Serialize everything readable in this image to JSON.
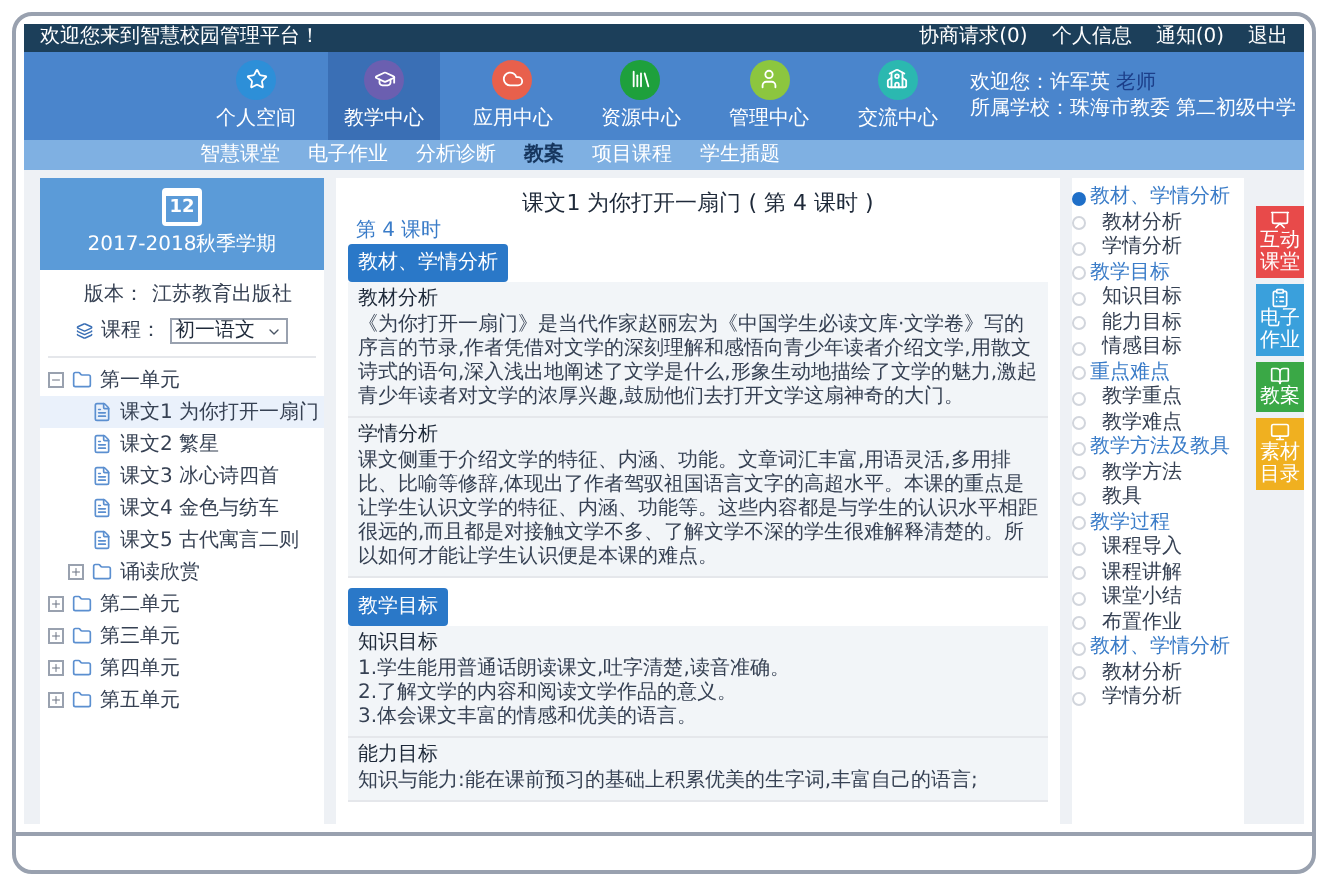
{
  "top_bar": {
    "welcome": "欢迎您来到智慧校园管理平台！",
    "links": [
      "协商请求(0)",
      "个人信息",
      "通知(0)",
      "退出"
    ]
  },
  "nav": {
    "items": [
      {
        "label": "个人空间",
        "color": "#2d8fd8",
        "selected": false
      },
      {
        "label": "教学中心",
        "color": "#6b5fb0",
        "selected": true
      },
      {
        "label": "应用中心",
        "color": "#e8604c",
        "selected": false
      },
      {
        "label": "资源中心",
        "color": "#1ea03c",
        "selected": false
      },
      {
        "label": "管理中心",
        "color": "#8cc63f",
        "selected": false
      },
      {
        "label": "交流中心",
        "color": "#2bb8b0",
        "selected": false
      }
    ],
    "user": {
      "greeting": "欢迎您：",
      "name": "许军英",
      "role": "老师",
      "school_label": "所属学校：",
      "school": "珠海市教委 第二初级中学"
    }
  },
  "sub_nav": [
    {
      "label": "智慧课堂",
      "selected": false
    },
    {
      "label": "电子作业",
      "selected": false
    },
    {
      "label": "分析诊断",
      "selected": false
    },
    {
      "label": "教案",
      "selected": true
    },
    {
      "label": "项目课程",
      "selected": false
    },
    {
      "label": "学生插题",
      "selected": false
    }
  ],
  "sidebar": {
    "calendar_day": "12",
    "term": "2017-2018秋季学期",
    "edition_label": "版本：",
    "edition": "江苏教育出版社",
    "course_label": "课程：",
    "course": "初一语文",
    "tree": [
      {
        "label": "第一单元",
        "kind": "folder",
        "expanded": true,
        "selected": false,
        "children": [
          {
            "label": "课文1 为你打开一扇门",
            "kind": "doc",
            "selected": true
          },
          {
            "label": "课文2 繁星",
            "kind": "doc",
            "selected": false
          },
          {
            "label": "课文3 冰心诗四首",
            "kind": "doc",
            "selected": false
          },
          {
            "label": "课文4 金色与纺车",
            "kind": "doc",
            "selected": false
          },
          {
            "label": "课文5 古代寓言二则",
            "kind": "doc",
            "selected": false
          },
          {
            "label": "诵读欣赏",
            "kind": "folder",
            "expanded": false,
            "selected": false
          }
        ]
      },
      {
        "label": "第二单元",
        "kind": "folder",
        "expanded": false,
        "selected": false
      },
      {
        "label": "第三单元",
        "kind": "folder",
        "expanded": false,
        "selected": false
      },
      {
        "label": "第四单元",
        "kind": "folder",
        "expanded": false,
        "selected": false
      },
      {
        "label": "第五单元",
        "kind": "folder",
        "expanded": false,
        "selected": false
      }
    ]
  },
  "lesson": {
    "title": "课文1 为你打开一扇门 ( 第 4 课时 )",
    "period_link": "第 4 课时",
    "sections": [
      {
        "heading": "教材、学情分析",
        "blocks": [
          {
            "title": "教材分析",
            "paragraphs": [
              "《为你打开一扇门》是当代作家赵丽宏为《中国学生必读文库·文学卷》写的序言的节录,作者凭借对文学的深刻理解和感悟向青少年读者介绍文学,用散文诗式的语句,深入浅出地阐述了文学是什么,形象生动地描绘了文学的魅力,激起青少年读者对文学的浓厚兴趣,鼓励他们去打开文学这扇神奇的大门。"
            ]
          },
          {
            "title": "学情分析",
            "paragraphs": [
              "课文侧重于介绍文学的特征、内涵、功能。文章词汇丰富,用语灵活,多用排比、比喻等修辞,体现出了作者驾驭祖国语言文字的高超水平。本课的重点是让学生认识文学的特征、内涵、功能等。这些内容都是与学生的认识水平相距很远的,而且都是对接触文学不多、了解文学不深的学生很难解释清楚的。所以如何才能让学生认识便是本课的难点。"
            ]
          }
        ]
      },
      {
        "heading": "教学目标",
        "blocks": [
          {
            "title": "知识目标",
            "paragraphs": [
              "1.学生能用普通话朗读课文,吐字清楚,读音准确。",
              "2.了解文学的内容和阅读文学作品的意义。",
              "3.体会课文丰富的情感和优美的语言。"
            ]
          },
          {
            "title": "能力目标",
            "paragraphs": [
              "知识与能力:能在课前预习的基础上积累优美的生字词,丰富自己的语言;"
            ]
          }
        ]
      }
    ]
  },
  "outline": [
    {
      "label": "教材、学情分析",
      "kind": "heading",
      "selected": true
    },
    {
      "label": "教材分析",
      "kind": "item",
      "selected": false
    },
    {
      "label": "学情分析",
      "kind": "item",
      "selected": false
    },
    {
      "label": "教学目标",
      "kind": "heading",
      "selected": false
    },
    {
      "label": "知识目标",
      "kind": "item",
      "selected": false
    },
    {
      "label": "能力目标",
      "kind": "item",
      "selected": false
    },
    {
      "label": "情感目标",
      "kind": "item",
      "selected": false
    },
    {
      "label": "重点难点",
      "kind": "heading",
      "selected": false
    },
    {
      "label": "教学重点",
      "kind": "item",
      "selected": false
    },
    {
      "label": "教学难点",
      "kind": "item",
      "selected": false
    },
    {
      "label": "教学方法及教具",
      "kind": "heading",
      "selected": false
    },
    {
      "label": "教学方法",
      "kind": "item",
      "selected": false
    },
    {
      "label": "教具",
      "kind": "item",
      "selected": false
    },
    {
      "label": "教学过程",
      "kind": "heading",
      "selected": false
    },
    {
      "label": "课程导入",
      "kind": "item",
      "selected": false
    },
    {
      "label": "课程讲解",
      "kind": "item",
      "selected": false
    },
    {
      "label": "课堂小结",
      "kind": "item",
      "selected": false
    },
    {
      "label": "布置作业",
      "kind": "item",
      "selected": false
    },
    {
      "label": "教材、学情分析",
      "kind": "heading",
      "selected": false
    },
    {
      "label": "教材分析",
      "kind": "item",
      "selected": false
    },
    {
      "label": "学情分析",
      "kind": "item",
      "selected": false
    }
  ],
  "quick_tiles": [
    {
      "label": "互动课堂",
      "color": "#e84a4a"
    },
    {
      "label": "电子作业",
      "color": "#3aa0dc"
    },
    {
      "label": "教案",
      "color": "#3aa846"
    },
    {
      "label": "素材目录",
      "color": "#f0b020"
    }
  ]
}
